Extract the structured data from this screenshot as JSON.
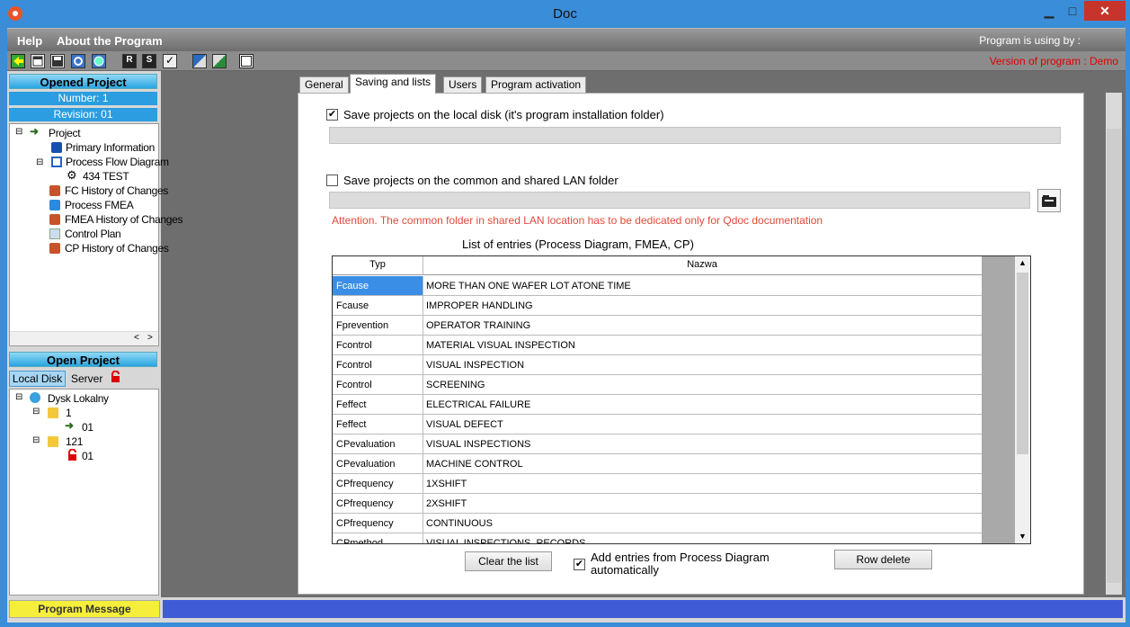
{
  "window": {
    "title": "Doc",
    "min": "▁",
    "max": "□",
    "close": "✕"
  },
  "menu": {
    "help": "Help",
    "about": "About the Program",
    "using": "Program is using by :"
  },
  "toolbar": {
    "version": "Version of program : Demo",
    "icons": [
      "back-icon",
      "new-icon",
      "save-icon",
      "settings-icon",
      "globe-icon",
      "report-r-icon",
      "report-s-icon",
      "check-icon",
      "window-left-icon",
      "window-right-icon",
      "window-frame-icon"
    ]
  },
  "left": {
    "opened_title": "Opened Project",
    "number": "Number: 1",
    "revision": "Revision: 01",
    "tree": [
      "Project",
      "Primary Information",
      "Process Flow Diagram",
      "434 TEST",
      "FC History of Changes",
      "Process FMEA",
      "FMEA History of Changes",
      "Control Plan",
      "CP History of Changes"
    ],
    "open_title": "Open Project",
    "tabs": {
      "local": "Local Disk",
      "server": "Server"
    },
    "disk_tree": [
      "Dysk Lokalny",
      "1",
      "01",
      "121",
      "01"
    ]
  },
  "tabs": [
    "General",
    "Saving and lists",
    "Users",
    "Program activation"
  ],
  "saving": {
    "local_label": "Save projects on the local disk (it's program installation folder)",
    "local_checked": true,
    "lan_label": "Save projects on the common and shared LAN folder",
    "lan_checked": false,
    "attention": "Attention. The common folder in shared LAN location has to be dedicated only for Qdoc documentation",
    "list_title": "List of entries (Process Diagram, FMEA, CP)"
  },
  "table": {
    "headers": [
      "Typ",
      "Nazwa"
    ],
    "rows": [
      [
        "Fcause",
        "MORE THAN ONE WAFER LOT ATONE TIME"
      ],
      [
        "Fcause",
        "IMPROPER HANDLING"
      ],
      [
        "Fprevention",
        "OPERATOR TRAINING"
      ],
      [
        "Fcontrol",
        "MATERIAL VISUAL INSPECTION"
      ],
      [
        "Fcontrol",
        "VISUAL INSPECTION"
      ],
      [
        "Fcontrol",
        "SCREENING"
      ],
      [
        "Feffect",
        "ELECTRICAL FAILURE"
      ],
      [
        "Feffect",
        "VISUAL DEFECT"
      ],
      [
        "CPevaluation",
        "VISUAL INSPECTIONS"
      ],
      [
        "CPevaluation",
        "MACHINE CONTROL"
      ],
      [
        "CPfrequency",
        "1XSHIFT"
      ],
      [
        "CPfrequency",
        "2XSHIFT"
      ],
      [
        "CPfrequency",
        "CONTINUOUS"
      ],
      [
        "CPmethod",
        "VISUAL INSPECTIONS, RECORDS"
      ]
    ]
  },
  "buttons": {
    "clear": "Clear the list",
    "add_label": "Add entries from Process Diagram automatically",
    "add_checked": true,
    "row_delete": "Row delete"
  },
  "status": {
    "message": "Program Message"
  }
}
